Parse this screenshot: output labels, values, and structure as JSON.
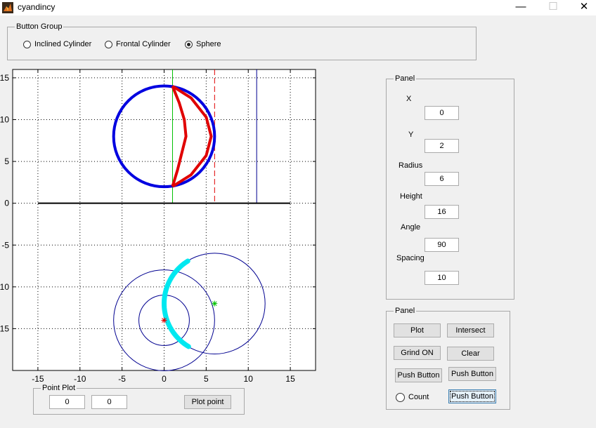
{
  "window": {
    "title": "cyandincy",
    "minimize": "—",
    "maximize": "☐",
    "close": "✕"
  },
  "button_group": {
    "label": "Button Group",
    "options": [
      {
        "label": "Inclined Cylinder",
        "selected": false
      },
      {
        "label": "Frontal Cylinder",
        "selected": false
      },
      {
        "label": "Sphere",
        "selected": true
      }
    ]
  },
  "params_panel": {
    "label": "Panel",
    "fields": [
      {
        "label": "X",
        "value": "0"
      },
      {
        "label": "Y",
        "value": "2"
      },
      {
        "label": "Radius",
        "value": "6"
      },
      {
        "label": "Height",
        "value": "16"
      },
      {
        "label": "Angle",
        "value": "90"
      },
      {
        "label": "Spacing",
        "value": "10"
      }
    ]
  },
  "actions_panel": {
    "label": "Panel",
    "plot": "Plot",
    "intersect": "Intersect",
    "grid_on": "Grind ON",
    "clear": "Clear",
    "push1": "Push Button",
    "push2": "Push Button",
    "count": "Count",
    "push3": "Push Button"
  },
  "point_plot": {
    "label": "Point Plot",
    "x": "0",
    "y": "0",
    "button": "Plot point"
  },
  "chart_data": {
    "type": "line",
    "xlim": [
      -18,
      18
    ],
    "ylim": [
      -20,
      16
    ],
    "xticks": [
      -15,
      -10,
      -5,
      0,
      5,
      10,
      15
    ],
    "yticks": [
      15,
      10,
      5,
      0,
      -5,
      -10,
      -15
    ],
    "xtick_labels": [
      "-15",
      "-10",
      "-5",
      "0",
      "5",
      "10",
      "15"
    ],
    "ytick_labels": [
      "15",
      "10",
      "5",
      "0",
      "-5",
      "-10",
      "-15"
    ],
    "grid": true,
    "colors": {
      "blue": "#0000e0",
      "red": "#e00000",
      "cyan": "#00e8f0",
      "green": "#00c000",
      "navy": "#000090",
      "black": "#000000"
    },
    "upper_circle": {
      "center": [
        0,
        8
      ],
      "radius": 6
    },
    "ground_line": {
      "y": 0,
      "x": [
        -15,
        15
      ]
    },
    "vertical_lines": {
      "green": 1,
      "red_dashed": 6,
      "navy": 11
    },
    "crescent": {
      "top": [
        1,
        14
      ],
      "bottom": [
        1,
        2
      ],
      "outer_right": [
        [
          1,
          14
        ],
        [
          3.2,
          12.6
        ],
        [
          5,
          10.3
        ],
        [
          5.6,
          8
        ],
        [
          5,
          5.7
        ],
        [
          3.2,
          3.4
        ],
        [
          1,
          2
        ]
      ],
      "inner_left": [
        [
          1,
          14
        ],
        [
          1.8,
          12
        ],
        [
          2.4,
          10
        ],
        [
          2.6,
          8
        ],
        [
          2.1,
          6
        ],
        [
          1.6,
          4
        ],
        [
          1,
          2
        ]
      ]
    },
    "lower_circles": [
      {
        "center": [
          0,
          -14
        ],
        "radius": 6
      },
      {
        "center": [
          0,
          -14
        ],
        "radius": 3
      },
      {
        "center": [
          6,
          -12
        ],
        "radius": 6
      }
    ],
    "cyan_arc": {
      "center": [
        6,
        -12
      ],
      "radius": 6,
      "start_deg": 122,
      "end_deg": 240
    },
    "markers": {
      "red_star": [
        0,
        -14
      ],
      "green_star": [
        6,
        -12
      ]
    }
  }
}
